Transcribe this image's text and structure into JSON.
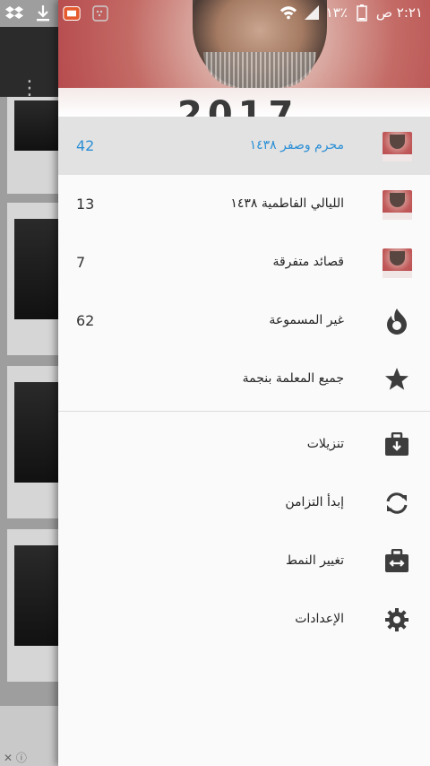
{
  "status_bar": {
    "time": "٢:٢١ ص",
    "battery": "١٣٪"
  },
  "header": {
    "year_text": "2017"
  },
  "menu": {
    "items": [
      {
        "label": "محرم وصفر ١٤٣٨",
        "count": "42",
        "icon": "album-thumbnail-icon",
        "selected": true
      },
      {
        "label": "الليالي الفاطمية ١٤٣٨",
        "count": "13",
        "icon": "album-thumbnail-icon",
        "selected": false
      },
      {
        "label": "قصائد متفرقة",
        "count": "7",
        "icon": "album-thumbnail-icon",
        "selected": false
      },
      {
        "label": "غير المسموعة",
        "count": "62",
        "icon": "flame-icon",
        "selected": false
      },
      {
        "label": "جميع المعلمة بنجمة",
        "count": "",
        "icon": "star-icon",
        "selected": false
      }
    ],
    "actions": [
      {
        "label": "تنزيلات",
        "icon": "download-briefcase-icon"
      },
      {
        "label": "إبدأ التزامن",
        "icon": "sync-icon"
      },
      {
        "label": "تغيير النمط",
        "icon": "swap-layout-icon"
      },
      {
        "label": "الإعدادات",
        "icon": "gear-icon"
      }
    ]
  },
  "colors": {
    "accent": "#2b8fd6",
    "icon_dark": "#3d3d3d",
    "selected_bg": "#e2e2e2"
  }
}
